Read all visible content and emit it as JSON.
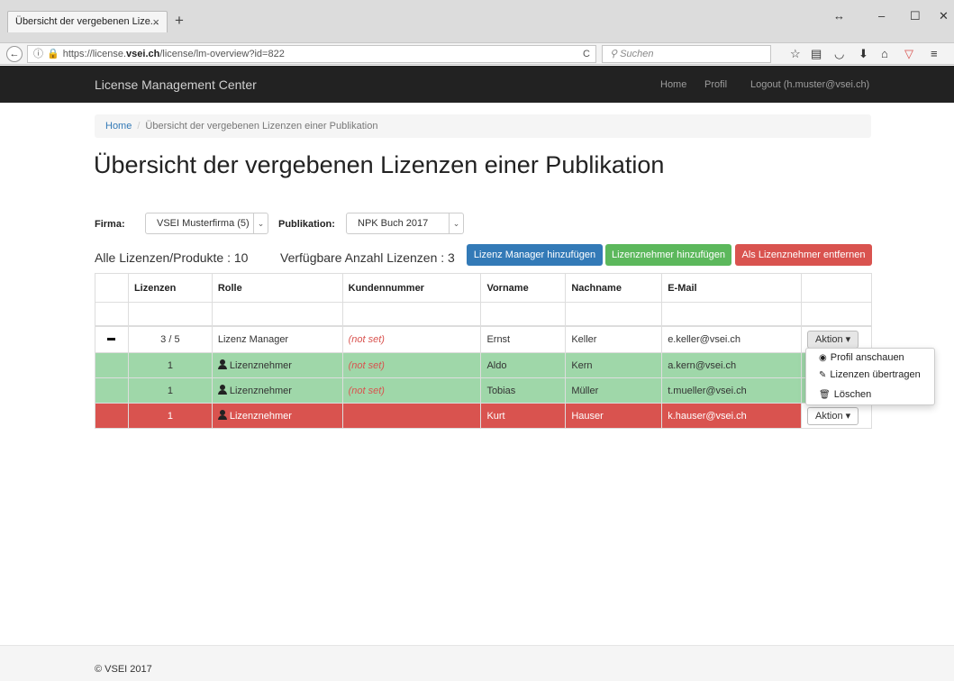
{
  "browser": {
    "tab_title": "Übersicht der vergebenen Lize...",
    "tab_close": "×",
    "new_tab": "+",
    "window_controls": [
      "↔",
      "–",
      "☐",
      "✕"
    ],
    "url_prefix": "https://license.",
    "url_domain": "vsei.ch",
    "url_path": "/license/lm-overview?id=822",
    "reload": "C",
    "search_placeholder": "Suchen"
  },
  "app": {
    "brand": "License Management Center",
    "nav": {
      "home": "Home",
      "profile": "Profil",
      "logout": "Logout (h.muster@vsei.ch)"
    }
  },
  "breadcrumb": {
    "home": "Home",
    "separator": "/",
    "current": "Übersicht der vergebenen Lizenzen einer Publikation"
  },
  "page_title": "Übersicht der vergebenen Lizenzen einer Publikation",
  "filters": {
    "firma_label": "Firma:",
    "firma_value": "VSEI Musterfirma (5)",
    "publikation_label": "Publikation:",
    "publikation_value": "NPK Buch 2017"
  },
  "stats": {
    "all_licenses": "Alle Lizenzen/Produkte : 10",
    "available": "Verfügbare Anzahl Lizenzen : 3"
  },
  "buttons": {
    "add_manager": "Lizenz Manager hinzufügen",
    "add_licensee": "Lizenznehmer hinzufügen",
    "remove_licensee": "Als Lizenznehmer entfernen"
  },
  "table": {
    "headers": [
      "",
      "Lizenzen",
      "Rolle",
      "Kundennummer",
      "Vorname",
      "Nachname",
      "E-Mail",
      ""
    ],
    "rows": [
      {
        "lizenzen": "3 / 5",
        "rolle": "Lizenz Manager",
        "kundennummer": "(not set)",
        "vorname": "Ernst",
        "nachname": "Keller",
        "email": "e.keller@vsei.ch",
        "aktion": "Aktion"
      },
      {
        "lizenzen": "1",
        "rolle": "Lizenznehmer",
        "kundennummer": "(not set)",
        "vorname": "Aldo",
        "nachname": "Kern",
        "email": "a.kern@vsei.ch"
      },
      {
        "lizenzen": "1",
        "rolle": "Lizenznehmer",
        "kundennummer": "(not set)",
        "vorname": "Tobias",
        "nachname": "Müller",
        "email": "t.mueller@vsei.ch"
      },
      {
        "lizenzen": "1",
        "rolle": "Lizenznehmer",
        "kundennummer": "",
        "vorname": "Kurt",
        "nachname": "Hauser",
        "email": "k.hauser@vsei.ch",
        "aktion": "Aktion"
      }
    ]
  },
  "dropdown": {
    "items": [
      "Profil anschauen",
      "Lizenzen übertragen",
      "Löschen"
    ]
  },
  "footer": "© VSEI 2017",
  "colors": {
    "navbar": "#222222",
    "row_green": "#9fd7a9",
    "row_red": "#d9534f",
    "btn_blue": "#337ab7",
    "btn_green": "#5cb85c",
    "btn_red": "#d9534f"
  }
}
